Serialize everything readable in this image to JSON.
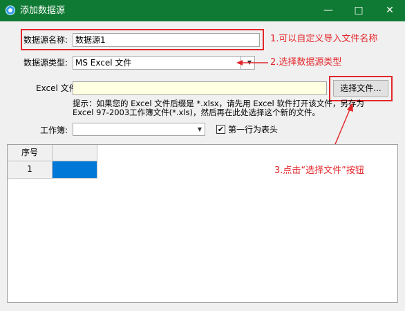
{
  "window": {
    "title": "添加数据源",
    "minimize_glyph": "—",
    "maximize_glyph": "□",
    "close_glyph": "✕"
  },
  "form": {
    "source_name_label": "数据源名称:",
    "source_name_value": "数据源1",
    "source_type_label": "数据源类型:",
    "source_type_value": "MS Excel 文件",
    "excel_file_label": "Excel 文件名:",
    "excel_file_value": "",
    "select_file_button": "选择文件...",
    "hint_line1": "提示：如果您的 Excel 文件后缀是 *.xlsx，请先用 Excel 软件打开该文件，另存为",
    "hint_line2": "Excel 97-2003工作簿文件(*.xls)，然后再在此处选择这个新的文件。",
    "sheet_label": "工作簿:",
    "sheet_value": "",
    "first_row_header_label": "第一行为表头",
    "first_row_header_checked": true,
    "checkbox_glyph": "✔",
    "dropdown_arrow": "▼"
  },
  "grid": {
    "headers": [
      "序号",
      ""
    ],
    "rows": [
      [
        "1",
        ""
      ]
    ]
  },
  "annotations": {
    "step1": "1.可以自定义导入文件名称",
    "step2": "2.选择数据源类型",
    "step3": "3.点击“选择文件”按钮",
    "color": "#e3262a"
  },
  "colors": {
    "titlebar": "#0f7a33",
    "selection": "#0078d7",
    "input_highlight": "#ffffe1"
  }
}
